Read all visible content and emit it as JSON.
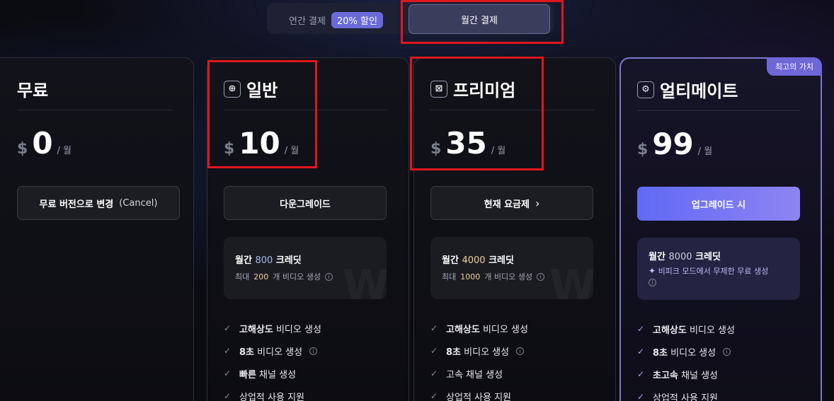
{
  "billing_toggle": {
    "annual_label": "연간 결제",
    "discount_badge": "20% 할인",
    "monthly_label": "월간 결제"
  },
  "plans": [
    {
      "name": "무료",
      "currency": "$",
      "price": "0",
      "period": "/ 월",
      "action_label": "무료 버전으로 변경",
      "action_sub": "(Cancel)"
    },
    {
      "name": "일반",
      "icon": "crosshair-icon",
      "currency": "$",
      "price": "10",
      "period": "/ 월",
      "action_label": "다운그레이드",
      "credits_prefix": "월간",
      "credits_num": "800",
      "credits_suffix": "크레딧",
      "videos_prefix": "최대",
      "videos_num": "200",
      "videos_suffix": "개 비디오 생성",
      "features": [
        {
          "bold": "고해상도",
          "rest": " 비디오 생성"
        },
        {
          "bold": "8초",
          "rest": " 비디오 생성"
        },
        {
          "bold": "빠른",
          "rest": " 채널 생성"
        },
        {
          "bold": "",
          "rest": "상업적 사용 지원"
        }
      ]
    },
    {
      "name": "프리미엄",
      "icon": "cross-box-icon",
      "currency": "$",
      "price": "35",
      "period": "/ 월",
      "action_label": "현재 요금제",
      "credits_prefix": "월간",
      "credits_num": "4000",
      "credits_suffix": "크레딧",
      "videos_prefix": "최대",
      "videos_num": "1000",
      "videos_suffix": "개 비디오 생성",
      "features": [
        {
          "bold": "고해상도",
          "rest": " 비디오 생성"
        },
        {
          "bold": "8초",
          "rest": " 비디오 생성"
        },
        {
          "bold": "",
          "rest": "고속 채널 생성"
        },
        {
          "bold": "",
          "rest": "상업적 사용 지원"
        }
      ]
    },
    {
      "name": "얼티메이트",
      "icon": "gear-icon",
      "best_tag": "최고의 가치",
      "currency": "$",
      "price": "99",
      "period": "/ 월",
      "action_label": "업그레이드 시",
      "credits_prefix": "월간",
      "credits_num": "8000",
      "credits_suffix": "크레딧",
      "extra_note": "비피크 모드에서 무제한 무료 생성",
      "features": [
        {
          "bold": "고해상도",
          "rest": " 비디오 생성"
        },
        {
          "bold": "8초",
          "rest": " 비디오 생성"
        },
        {
          "bold": "초고속",
          "rest": " 채널 생성"
        },
        {
          "bold": "",
          "rest": "상업적 사용 지원"
        }
      ]
    }
  ],
  "colors": {
    "accent": "#6f66d8",
    "highlight_box": "#e0161e",
    "background": "#0b0b12"
  }
}
